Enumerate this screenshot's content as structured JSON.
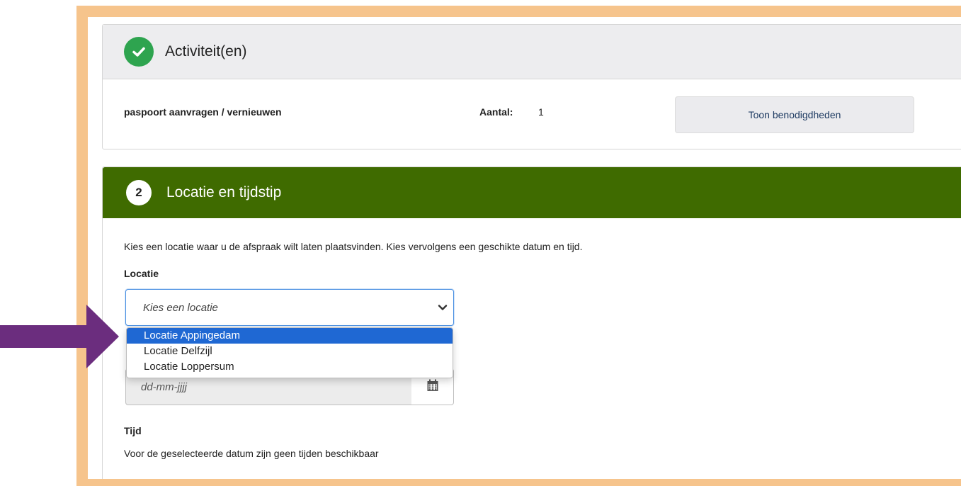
{
  "activities": {
    "header_title": "Activiteit(en)",
    "activity_name": "paspoort aanvragen / vernieuwen",
    "count_label": "Aantal:",
    "count_value": "1",
    "show_button_label": "Toon benodigdheden"
  },
  "location_time": {
    "step_number": "2",
    "header_title": "Locatie en tijdstip",
    "intro_text": "Kies een locatie waar u de afspraak wilt laten plaatsvinden. Kies vervolgens een geschikte datum en tijd.",
    "location_label": "Locatie",
    "location_select_value": "Kies een locatie",
    "location_options": [
      "Locatie Appingedam",
      "Locatie Delfzijl",
      "Locatie Loppersum"
    ],
    "date_placeholder": "dd-mm-jjjj",
    "time_label": "Tijd",
    "time_message": "Voor de geselecteerde datum zijn geen tijden beschikbaar"
  },
  "colors": {
    "frame": "#f6c48c",
    "success_green": "#2ea44f",
    "header_green": "#3f6b00",
    "arrow_purple": "#6b2d7e",
    "option_highlight": "#1f68d3"
  },
  "icons": [
    "check-icon",
    "chevron-down-icon",
    "calendar-icon",
    "arrow-right-icon"
  ]
}
